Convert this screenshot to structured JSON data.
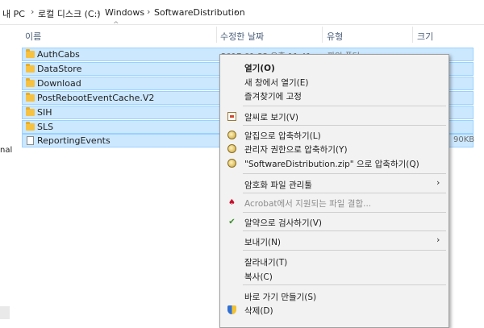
{
  "breadcrumb": [
    "내 PC",
    "로컬 디스크 (C:)",
    "Windows",
    "SoftwareDistribution"
  ],
  "nav_partial_text": "nal",
  "columns": {
    "name": "이름",
    "modified": "수정한 날짜",
    "type": "유형",
    "size": "크기"
  },
  "rows": [
    {
      "name": "AuthCabs",
      "kind": "folder",
      "modified": "2017-01-22 오후 11:41",
      "type": "파일 폴더"
    },
    {
      "name": "DataStore",
      "kind": "folder"
    },
    {
      "name": "Download",
      "kind": "folder"
    },
    {
      "name": "PostRebootEventCache.V2",
      "kind": "folder"
    },
    {
      "name": "SIH",
      "kind": "folder"
    },
    {
      "name": "SLS",
      "kind": "folder"
    },
    {
      "name": "ReportingEvents",
      "kind": "file",
      "size_partial": "90KB"
    }
  ],
  "menu": {
    "open": "열기(O)",
    "open_new_window": "새 창에서 열기(E)",
    "pin_quick_access": "즐겨찾기에 고정",
    "alzip_view": "알씨로 보기(V)",
    "compress_alzip": "알집으로 압축하기(L)",
    "compress_admin": "관리자 권한으로 압축하기(Y)",
    "compress_zip": "\"SoftwareDistribution.zip\" 으로 압축하기(Q)",
    "encrypted_files": "암호화 파일 관리툴",
    "acrobat_combine": "Acrobat에서 지원되는 파일 결합...",
    "scan_alyac": "알약으로 검사하기(V)",
    "send_to": "보내기(N)",
    "cut": "잘라내기(T)",
    "copy": "복사(C)",
    "create_shortcut": "바로 가기 만들기(S)",
    "delete": "삭제(D)"
  },
  "colors": {
    "selection_bg": "#cce8ff",
    "selection_border": "#99d1ff",
    "menu_bg": "#f2f2f2",
    "folder": "#f6c243"
  }
}
